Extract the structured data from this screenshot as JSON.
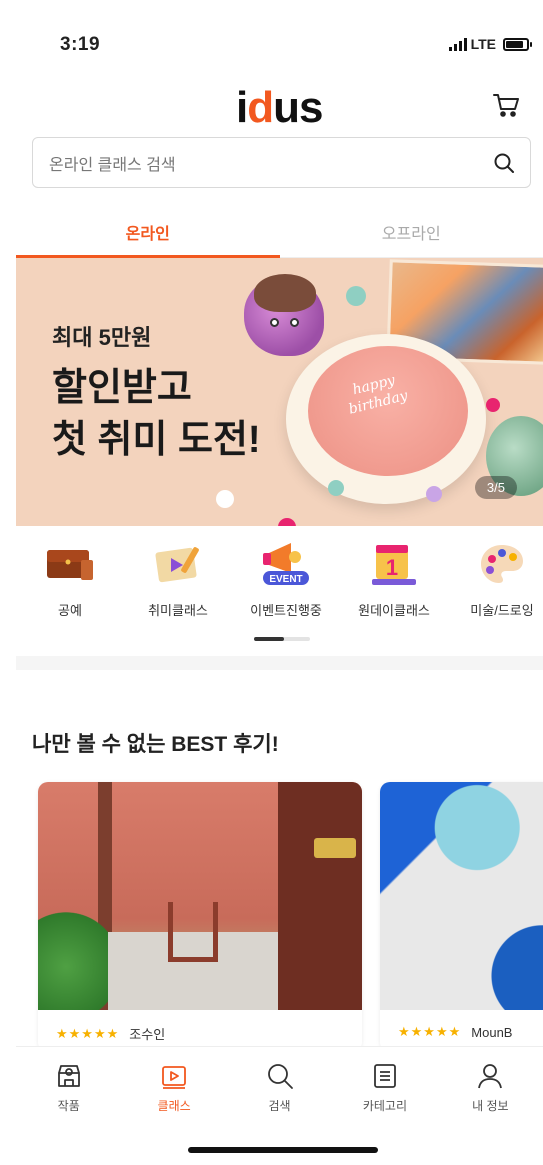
{
  "status": {
    "time": "3:19",
    "network": "LTE"
  },
  "header": {
    "logo_prefix": "i",
    "logo_o": "d",
    "logo_suffix": "us"
  },
  "search": {
    "placeholder": "온라인 클래스 검색"
  },
  "tabs": [
    {
      "label": "온라인",
      "active": true
    },
    {
      "label": "오프라인",
      "active": false
    }
  ],
  "banner": {
    "small": "최대 5만원",
    "line1": "할인받고",
    "line2": "첫 취미 도전!",
    "cake_line1": "happy",
    "cake_line2": "birthday",
    "counter": "3/5"
  },
  "categories": [
    {
      "label": "공예",
      "icon": "leather-wallet-icon"
    },
    {
      "label": "취미클래스",
      "icon": "pencil-board-icon"
    },
    {
      "label": "이벤트진행중",
      "icon": "megaphone-event-icon",
      "badge": "EVENT"
    },
    {
      "label": "원데이클래스",
      "icon": "calendar-one-icon",
      "badge": "1"
    },
    {
      "label": "미술/드로잉",
      "icon": "palette-icon"
    }
  ],
  "reviews": {
    "title": "나만 볼 수 없는 BEST 후기!",
    "cards": [
      {
        "stars": "★★★★★",
        "author": "조수인"
      },
      {
        "stars": "★★★★★",
        "author": "MounB"
      }
    ]
  },
  "bottom_nav": [
    {
      "label": "작품",
      "icon": "shop-icon",
      "active": false
    },
    {
      "label": "클래스",
      "icon": "class-play-icon",
      "active": true
    },
    {
      "label": "검색",
      "icon": "search-icon",
      "active": false
    },
    {
      "label": "카테고리",
      "icon": "category-list-icon",
      "active": false
    },
    {
      "label": "내 정보",
      "icon": "profile-icon",
      "active": false
    }
  ],
  "colors": {
    "accent": "#f2581f",
    "star": "#f7b100",
    "banner_bg": "#f3d3bd"
  }
}
